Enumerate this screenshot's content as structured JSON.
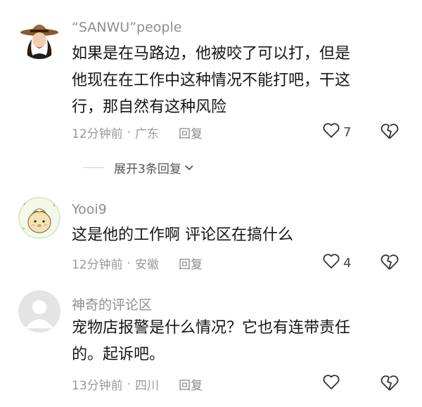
{
  "comments": [
    {
      "username": "“SANWU”people",
      "body_lines": [
        "如果是在马路边，他被咬了可以打，但是",
        "他现在在工作中这种情况不能打吧，干这",
        "行，那自然有这种风险"
      ],
      "time": "12分钟前",
      "location": "广东",
      "reply_label": "回复",
      "likes": "7"
    },
    {
      "username": "Yooi9",
      "body_lines": [
        "这是他的工作啊 评论区在搞什么"
      ],
      "time": "12分钟前",
      "location": "安徽",
      "reply_label": "回复",
      "likes": "4"
    },
    {
      "username": "神奇的评论区",
      "body_lines": [
        "宠物店报警是什么情况？它也有连带责任",
        "的。起诉吧。"
      ],
      "time": "13分钟前",
      "location": "四川",
      "reply_label": "回复",
      "likes": ""
    }
  ],
  "expand_replies_label": "展开3条回复",
  "icons": {
    "like": "heart-outline-icon",
    "dislike": "broken-heart-icon",
    "expand": "chevron-down-icon"
  },
  "colors": {
    "username": "#8e8e8e",
    "meta": "#9a9a9a",
    "text": "#161616"
  }
}
